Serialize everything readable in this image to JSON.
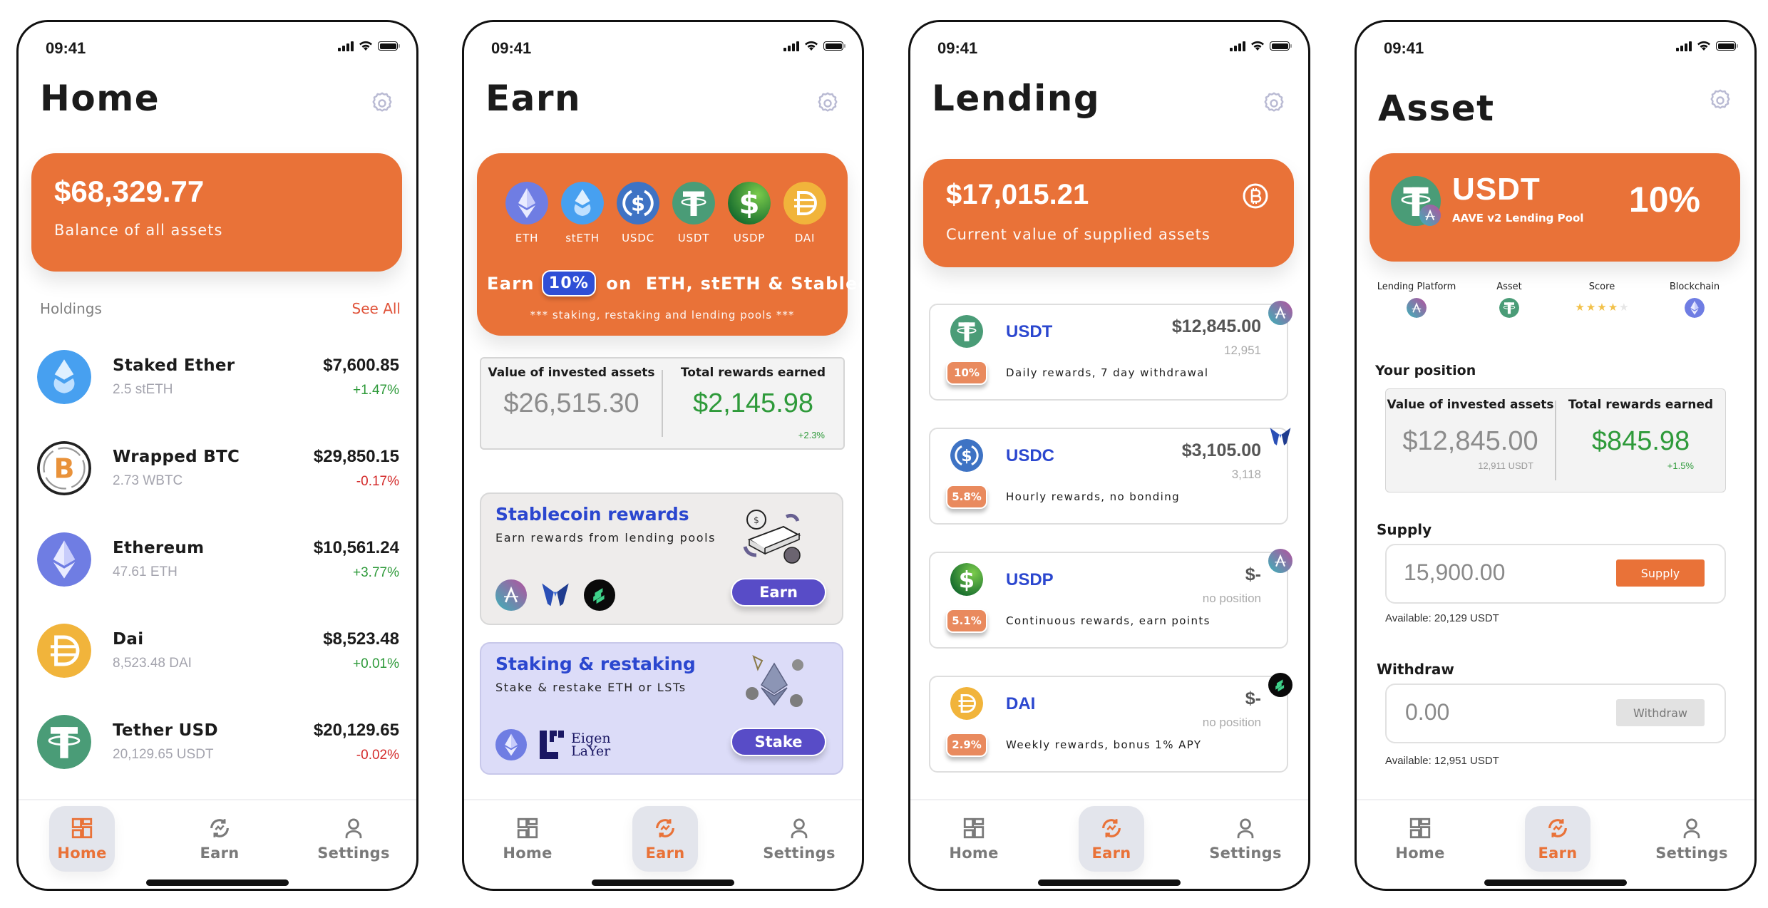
{
  "status_bar": {
    "time": "09:41"
  },
  "tabs": [
    {
      "label": "Home",
      "icon": "grid-icon"
    },
    {
      "label": "Earn",
      "icon": "earn-cycle-icon"
    },
    {
      "label": "Settings",
      "icon": "user-icon"
    }
  ],
  "colors": {
    "accent": "#e97238",
    "link_blue": "#2b47cf",
    "button_purple": "#584cc7",
    "positive": "#2e9a3a",
    "negative": "#d42b2b"
  },
  "home": {
    "title": "Home",
    "hero": {
      "amount": "$68,329.77",
      "subtitle": "Balance of all assets"
    },
    "holdings_label": "Holdings",
    "see_all": "See All",
    "holdings": [
      {
        "name": "Staked Ether",
        "qty": "2.5 stETH",
        "value": "$7,600.85",
        "change": "+1.47%",
        "trend": "pos",
        "icon": "steth-icon"
      },
      {
        "name": "Wrapped BTC",
        "qty": "2.73 WBTC",
        "value": "$29,850.15",
        "change": "-0.17%",
        "trend": "neg",
        "icon": "wbtc-icon"
      },
      {
        "name": "Ethereum",
        "qty": "47.61 ETH",
        "value": "$10,561.24",
        "change": "+3.77%",
        "trend": "pos",
        "icon": "eth-icon"
      },
      {
        "name": "Dai",
        "qty": "8,523.48 DAI",
        "value": "$8,523.48",
        "change": "+0.01%",
        "trend": "pos",
        "icon": "dai-icon"
      },
      {
        "name": "Tether USD",
        "qty": "20,129.65 USDT",
        "value": "$20,129.65",
        "change": "-0.02%",
        "trend": "neg",
        "icon": "usdt-icon"
      }
    ],
    "active_tab": "Home"
  },
  "earn": {
    "title": "Earn",
    "coins": [
      "ETH",
      "stETH",
      "USDC",
      "USDT",
      "USDP",
      "DAI"
    ],
    "earn_prefix": "Earn",
    "earn_rate": "10%",
    "earn_suffix": "on  ETH, stETH & Stablecoins",
    "earn_footnote": "*** staking, restaking and lending pools ***",
    "stats": {
      "invested_label": "Value of invested assets",
      "invested_value": "$26,515.30",
      "rewards_label": "Total rewards earned",
      "rewards_value": "$2,145.98",
      "rewards_change": "+2.3%"
    },
    "promos": [
      {
        "title": "Stablecoin rewards",
        "subtitle": "Earn rewards from lending pools",
        "button": "Earn",
        "logos": [
          "aave-icon",
          "morpho-icon",
          "compound-icon"
        ]
      },
      {
        "title": "Staking & restaking",
        "subtitle": "Stake & restake ETH or LSTs",
        "button": "Stake",
        "logos": [
          "eth-icon",
          "eigenlayer-logo"
        ],
        "eigen_line1": "Eigen",
        "eigen_line2": "LaYer"
      }
    ],
    "active_tab": "Earn"
  },
  "lending": {
    "title": "Lending",
    "hero": {
      "amount": "$17,015.21",
      "subtitle": "Current value of supplied assets"
    },
    "pools": [
      {
        "name": "USDT",
        "amount": "$12,845.00",
        "qty": "12,951",
        "apy": "10%",
        "desc": "Daily rewards, 7 day withdrawal",
        "platform": "aave-icon"
      },
      {
        "name": "USDC",
        "amount": "$3,105.00",
        "qty": "3,118",
        "apy": "5.8%",
        "desc": "Hourly rewards, no bonding",
        "platform": "morpho-icon"
      },
      {
        "name": "USDP",
        "amount": "$-",
        "qty": "no position",
        "apy": "5.1%",
        "desc": "Continuous rewards, earn points",
        "platform": "aave-icon"
      },
      {
        "name": "DAI",
        "amount": "$-",
        "qty": "no position",
        "apy": "2.9%",
        "desc": "Weekly rewards, bonus 1% APY",
        "platform": "compound-icon"
      }
    ],
    "active_tab": "Earn"
  },
  "asset": {
    "title": "Asset",
    "hero": {
      "symbol": "USDT",
      "pool": "AAVE v2 Lending Pool",
      "apy": "10%"
    },
    "meta": {
      "platform_label": "Lending Platform",
      "asset_label": "Asset",
      "score_label": "Score",
      "score_value": 4,
      "score_max": 5,
      "chain_label": "Blockchain"
    },
    "position_label": "Your position",
    "stats": {
      "invested_label": "Value of invested assets",
      "invested_value": "$12,845.00",
      "invested_sub": "12,911 USDT",
      "rewards_label": "Total rewards earned",
      "rewards_value": "$845.98",
      "rewards_change": "+1.5%"
    },
    "supply": {
      "label": "Supply",
      "value": "15,900.00",
      "button": "Supply",
      "available": "Available: 20,129 USDT"
    },
    "withdraw": {
      "label": "Withdraw",
      "value": "0.00",
      "button": "Withdraw",
      "available": "Available: 12,951 USDT"
    },
    "active_tab": "Earn"
  }
}
